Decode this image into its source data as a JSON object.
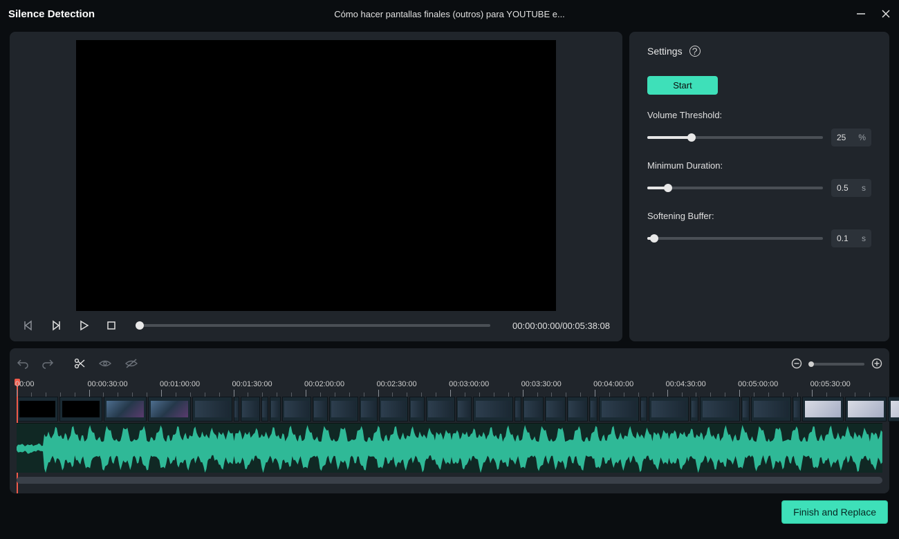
{
  "titlebar": {
    "app_title": "Silence Detection",
    "doc_title": "Cómo hacer pantallas finales (outros) para YOUTUBE e..."
  },
  "preview": {
    "timecode": "00:00:00:00/00:05:38:08"
  },
  "settings": {
    "header": "Settings",
    "start_label": "Start",
    "volume_threshold_label": "Volume Threshold:",
    "volume_threshold_value": "25",
    "volume_threshold_unit": "%",
    "volume_threshold_pct": 25,
    "min_duration_label": "Minimum Duration:",
    "min_duration_value": "0.5",
    "min_duration_unit": "s",
    "min_duration_pct": 12,
    "softening_label": "Softening Buffer:",
    "softening_value": "0.1",
    "softening_unit": "s",
    "softening_pct": 4
  },
  "timeline": {
    "ruler_labels": [
      "00:00",
      "00:00:30:00",
      "00:01:00:00",
      "00:01:30:00",
      "00:02:00:00",
      "00:02:30:00",
      "00:03:00:00",
      "00:03:30:00",
      "00:04:00:00",
      "00:04:30:00",
      "00:05:00:00",
      "00:05:30:00"
    ]
  },
  "footer": {
    "finish_label": "Finish and Replace"
  },
  "icons": {
    "minimize": "minimize-icon",
    "close": "close-icon",
    "step_back": "step-back-icon",
    "step_fwd": "step-forward-icon",
    "play": "play-icon",
    "stop": "stop-icon",
    "undo": "undo-icon",
    "redo": "redo-icon",
    "cut": "scissors-icon",
    "eye": "eye-icon",
    "eye_off": "eye-off-icon",
    "zoom_out": "zoom-out-icon",
    "zoom_in": "zoom-in-icon",
    "help": "help-icon"
  }
}
